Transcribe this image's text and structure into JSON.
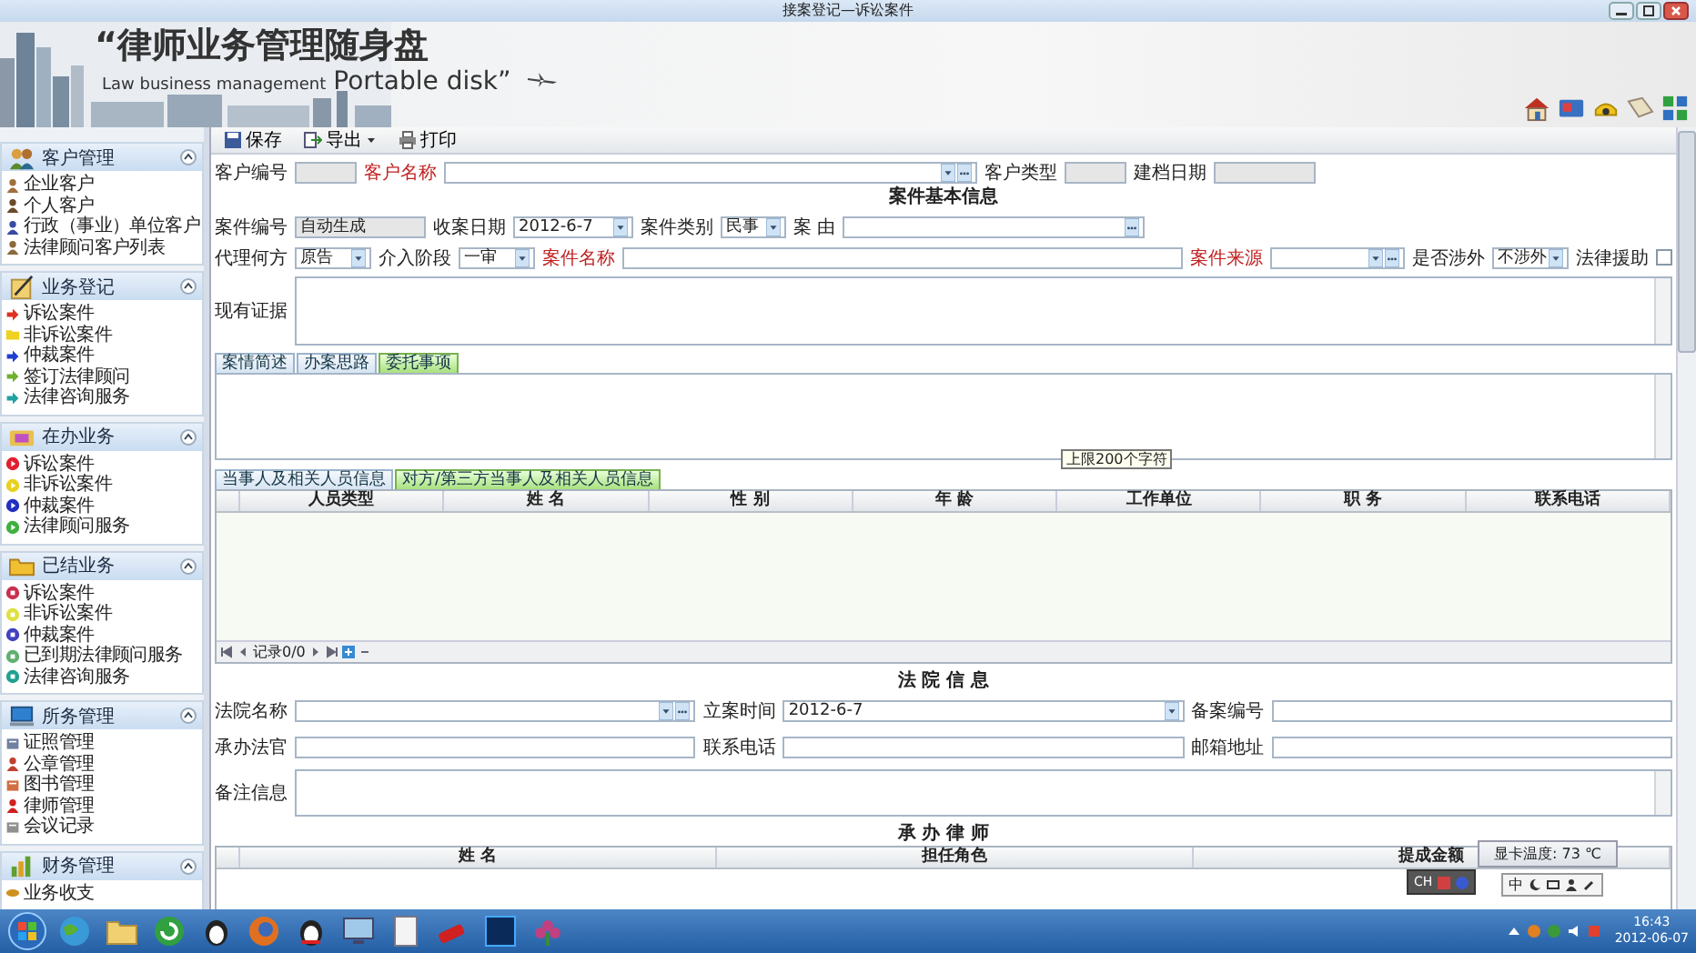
{
  "window": {
    "title": "接案登记—诉讼案件"
  },
  "banner": {
    "title": "“律师业务管理随身盘",
    "subtitle_small": "Law business management",
    "subtitle_large": "Portable disk”"
  },
  "sidebar": {
    "groups": [
      {
        "title": "客户管理",
        "kind": "people",
        "items": [
          {
            "label": "企业客户",
            "kind": "person",
            "color": "#a0703c"
          },
          {
            "label": "个人客户",
            "kind": "person",
            "color": "#6b4a2a"
          },
          {
            "label": "行政（事业）单位客户",
            "kind": "person",
            "color": "#3a4aa0"
          },
          {
            "label": "法律顾问客户列表",
            "kind": "person",
            "color": "#8a6a3a"
          }
        ]
      },
      {
        "title": "业务登记",
        "kind": "pen",
        "items": [
          {
            "label": "诉讼案件",
            "kind": "arrow",
            "color": "#e03020"
          },
          {
            "label": "非诉讼案件",
            "kind": "folder",
            "color": "#f0d020"
          },
          {
            "label": "仲裁案件",
            "kind": "arrow",
            "color": "#2040d0"
          },
          {
            "label": "签订法律顾问",
            "kind": "arrow",
            "color": "#70b030"
          },
          {
            "label": "法律咨询服务",
            "kind": "arrow",
            "color": "#20a0a0"
          }
        ]
      },
      {
        "title": "在办业务",
        "kind": "case",
        "items": [
          {
            "label": "诉讼案件",
            "kind": "play",
            "color": "#e02030"
          },
          {
            "label": "非诉讼案件",
            "kind": "play",
            "color": "#e8d020"
          },
          {
            "label": "仲裁案件",
            "kind": "play",
            "color": "#2030c0"
          },
          {
            "label": "法律顾问服务",
            "kind": "play",
            "color": "#40b040"
          }
        ]
      },
      {
        "title": "已结业务",
        "kind": "folder",
        "items": [
          {
            "label": "诉讼案件",
            "kind": "stop",
            "color": "#c83050"
          },
          {
            "label": "非诉讼案件",
            "kind": "stop",
            "color": "#e0e040"
          },
          {
            "label": "仲裁案件",
            "kind": "stop",
            "color": "#4040c0"
          },
          {
            "label": "已到期法律顾问服务",
            "kind": "stop",
            "color": "#60b070"
          },
          {
            "label": "法律咨询服务",
            "kind": "stop",
            "color": "#20a090"
          }
        ]
      },
      {
        "title": "所务管理",
        "kind": "computer",
        "items": [
          {
            "label": "证照管理",
            "kind": "square",
            "color": "#7080a0"
          },
          {
            "label": "公章管理",
            "kind": "person",
            "color": "#c04030"
          },
          {
            "label": "图书管理",
            "kind": "square",
            "color": "#d07040"
          },
          {
            "label": "律师管理",
            "kind": "person",
            "color": "#d02020"
          },
          {
            "label": "会议记录",
            "kind": "square",
            "color": "#909090"
          }
        ]
      },
      {
        "title": "财务管理",
        "kind": "chart",
        "items": [
          {
            "label": "业务收支",
            "kind": "coin",
            "color": "#d09020"
          }
        ]
      }
    ]
  },
  "toolbar": [
    {
      "label": "保存",
      "kind": "save",
      "dropdown": false
    },
    {
      "label": "导出",
      "kind": "export",
      "dropdown": true
    },
    {
      "label": "打印",
      "kind": "print",
      "dropdown": false
    }
  ],
  "client_row": {
    "client_no": {
      "label": "客户编号",
      "required": false
    },
    "client_name": {
      "label": "客户名称",
      "required": true
    },
    "client_type": {
      "label": "客户类型",
      "required": false
    },
    "file_date": {
      "label": "建档日期",
      "required": false
    }
  },
  "case_section": {
    "heading": "案件基本信息",
    "case_no": {
      "label": "案件编号",
      "value": "自动生成",
      "required": false
    },
    "receive_date": {
      "label": "收案日期",
      "value": "2012-6-7",
      "required": false
    },
    "case_type": {
      "label": "案件类别",
      "value": "民事",
      "required": false
    },
    "cause": {
      "label": "案 由",
      "required": false
    },
    "agent_side": {
      "label": "代理何方",
      "value": "原告",
      "required": false
    },
    "stage": {
      "label": "介入阶段",
      "value": "一审",
      "required": false
    },
    "case_name": {
      "label": "案件名称",
      "required": true
    },
    "source": {
      "label": "案件来源",
      "required": true
    },
    "foreign": {
      "label": "是否涉外",
      "value": "不涉外",
      "required": false
    },
    "legal_aid": {
      "label": "法律援助",
      "checked": false,
      "required": false
    },
    "evidence": {
      "label": "现有证据",
      "required": false
    }
  },
  "detail_tabs": {
    "tabs": [
      {
        "label": "案情简述",
        "selected": false
      },
      {
        "label": "办案思路",
        "selected": false
      },
      {
        "label": "委托事项",
        "selected": true
      }
    ],
    "tooltip": "上限200个字符"
  },
  "party_tabs": {
    "tabs": [
      {
        "label": "当事人及相关人员信息",
        "selected": false
      },
      {
        "label": "对方/第三方当事人及相关人员信息",
        "selected": true
      }
    ],
    "columns": [
      "人员类型",
      "姓 名",
      "性 别",
      "年 龄",
      "工作单位",
      "职 务",
      "联系电话"
    ],
    "pager": "记录0/0"
  },
  "court_section": {
    "heading": "法 院 信 息",
    "court_name": {
      "label": "法院名称",
      "required": false
    },
    "filing_time": {
      "label": "立案时间",
      "value": "2012-6-7",
      "required": false
    },
    "record_no": {
      "label": "备案编号",
      "required": false
    },
    "judge": {
      "label": "承办法官",
      "required": false
    },
    "phone": {
      "label": "联系电话",
      "required": false
    },
    "address": {
      "label": "邮箱地址",
      "required": false
    },
    "remarks": {
      "label": "备注信息",
      "required": false
    }
  },
  "lawyer_section": {
    "heading": "承 办 律 师",
    "columns": [
      "姓 名",
      "担任角色",
      "提成金额"
    ]
  },
  "overlays": {
    "gpu_temp": "显卡温度: 73 ℃",
    "ime": [
      "CH",
      "中"
    ]
  },
  "taskbar": {
    "time": "16:43",
    "date": "2012-06-07"
  }
}
